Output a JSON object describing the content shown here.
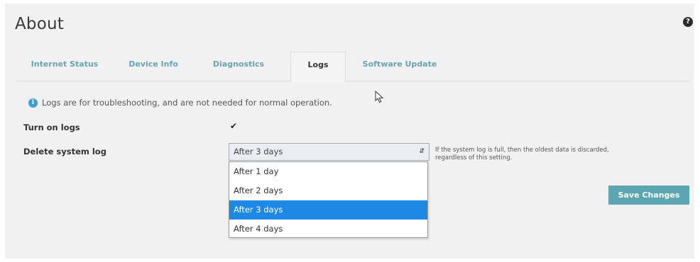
{
  "page": {
    "title": "About"
  },
  "tabs": [
    {
      "label": "Internet Status",
      "active": false
    },
    {
      "label": "Device Info",
      "active": false
    },
    {
      "label": "Diagnostics",
      "active": false
    },
    {
      "label": "Logs",
      "active": true
    },
    {
      "label": "Software Update",
      "active": false
    }
  ],
  "info": {
    "text": "Logs are for troubleshooting, and are not needed for normal operation."
  },
  "form": {
    "turn_on_logs_label": "Turn on logs",
    "turn_on_logs_checked": true,
    "checkbox_glyph": "✔",
    "delete_log_label": "Delete system log",
    "delete_log_value": "After 3 days",
    "delete_log_options": [
      "After 1 day",
      "After 2 days",
      "After 3 days",
      "After 4 days"
    ],
    "help_text": "If the system log is full, then the oldest data is discarded, regardless of this setting."
  },
  "actions": {
    "save_label": "Save Changes"
  },
  "icons": {
    "help": "question-circle-icon",
    "info": "info-circle-icon",
    "cursor": "mouse-pointer-icon"
  },
  "colors": {
    "accent": "#5ba6b0",
    "tab_inactive": "#6aa3ad",
    "selected_option": "#1e88e5",
    "info_icon": "#3ea0cc"
  }
}
